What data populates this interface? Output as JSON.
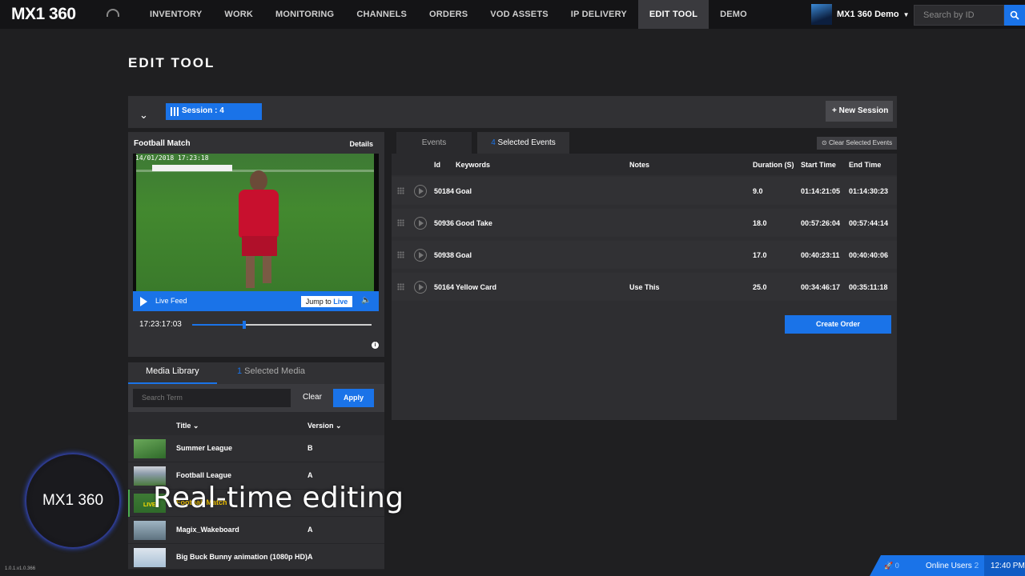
{
  "app": {
    "logo": "MX1 360"
  },
  "nav": [
    "INVENTORY",
    "WORK",
    "MONITORING",
    "CHANNELS",
    "ORDERS",
    "VOD ASSETS",
    "IP DELIVERY",
    "EDIT TOOL",
    "DEMO"
  ],
  "user": {
    "name": "MX1 360 Demo"
  },
  "search": {
    "placeholder": "Search by ID"
  },
  "page": {
    "title": "EDIT TOOL"
  },
  "session": {
    "label": "Session : 4",
    "new_label": "New Session"
  },
  "video": {
    "title": "Football Match",
    "details": "Details",
    "timestamp": "14/01/2018 17:23:18",
    "live_label": "Live Feed",
    "jump_prefix": "Jump to ",
    "jump_live": "Live",
    "time": "17:23:17:03",
    "progress": 0.29
  },
  "media": {
    "tab_library": "Media Library",
    "selected_count": "1",
    "selected_label": " Selected Media",
    "search_placeholder": "Search Term",
    "clear": "Clear",
    "apply": "Apply",
    "col_title": "Title",
    "col_version": "Version",
    "rows": [
      {
        "title": "Summer League",
        "version": "B"
      },
      {
        "title": "Football League",
        "version": "A"
      },
      {
        "title": "Football Match",
        "version": "",
        "badge": "LIVE"
      },
      {
        "title": "Magix_Wakeboard",
        "version": "A"
      },
      {
        "title": "Big Buck Bunny animation (1080p HD)",
        "version": "A"
      }
    ]
  },
  "events": {
    "tab_events": "Events",
    "selected_count": "4",
    "selected_label": " Selected Events",
    "clear_selected": "Clear Selected Events",
    "columns": {
      "id": "Id",
      "keywords": "Keywords",
      "notes": "Notes",
      "duration": "Duration (S)",
      "start": "Start Time",
      "end": "End Time"
    },
    "rows": [
      {
        "id": "50184",
        "keyword": "Goal",
        "notes": "",
        "duration": "9.0",
        "start": "01:14:21:05",
        "end": "01:14:30:23"
      },
      {
        "id": "50936",
        "keyword": "Good Take",
        "notes": "",
        "duration": "18.0",
        "start": "00:57:26:04",
        "end": "00:57:44:14"
      },
      {
        "id": "50938",
        "keyword": "Goal",
        "notes": "",
        "duration": "17.0",
        "start": "00:40:23:11",
        "end": "00:40:40:06"
      },
      {
        "id": "50164",
        "keyword": "Yellow Card",
        "notes": "Use This",
        "duration": "25.0",
        "start": "00:34:46:17",
        "end": "00:35:11:18"
      }
    ],
    "create_order": "Create Order"
  },
  "overlay": {
    "circle_logo": "MX1 360",
    "caption": "Real-time editing"
  },
  "footer": {
    "version": "1.0.1.v1.0.366"
  },
  "status": {
    "rocket_count": "0",
    "online_label": "Online Users",
    "online_count": "2",
    "time": "12:40 PM"
  },
  "colors": {
    "accent": "#1a73e8",
    "background": "#1f1f21",
    "panel": "#313134"
  }
}
